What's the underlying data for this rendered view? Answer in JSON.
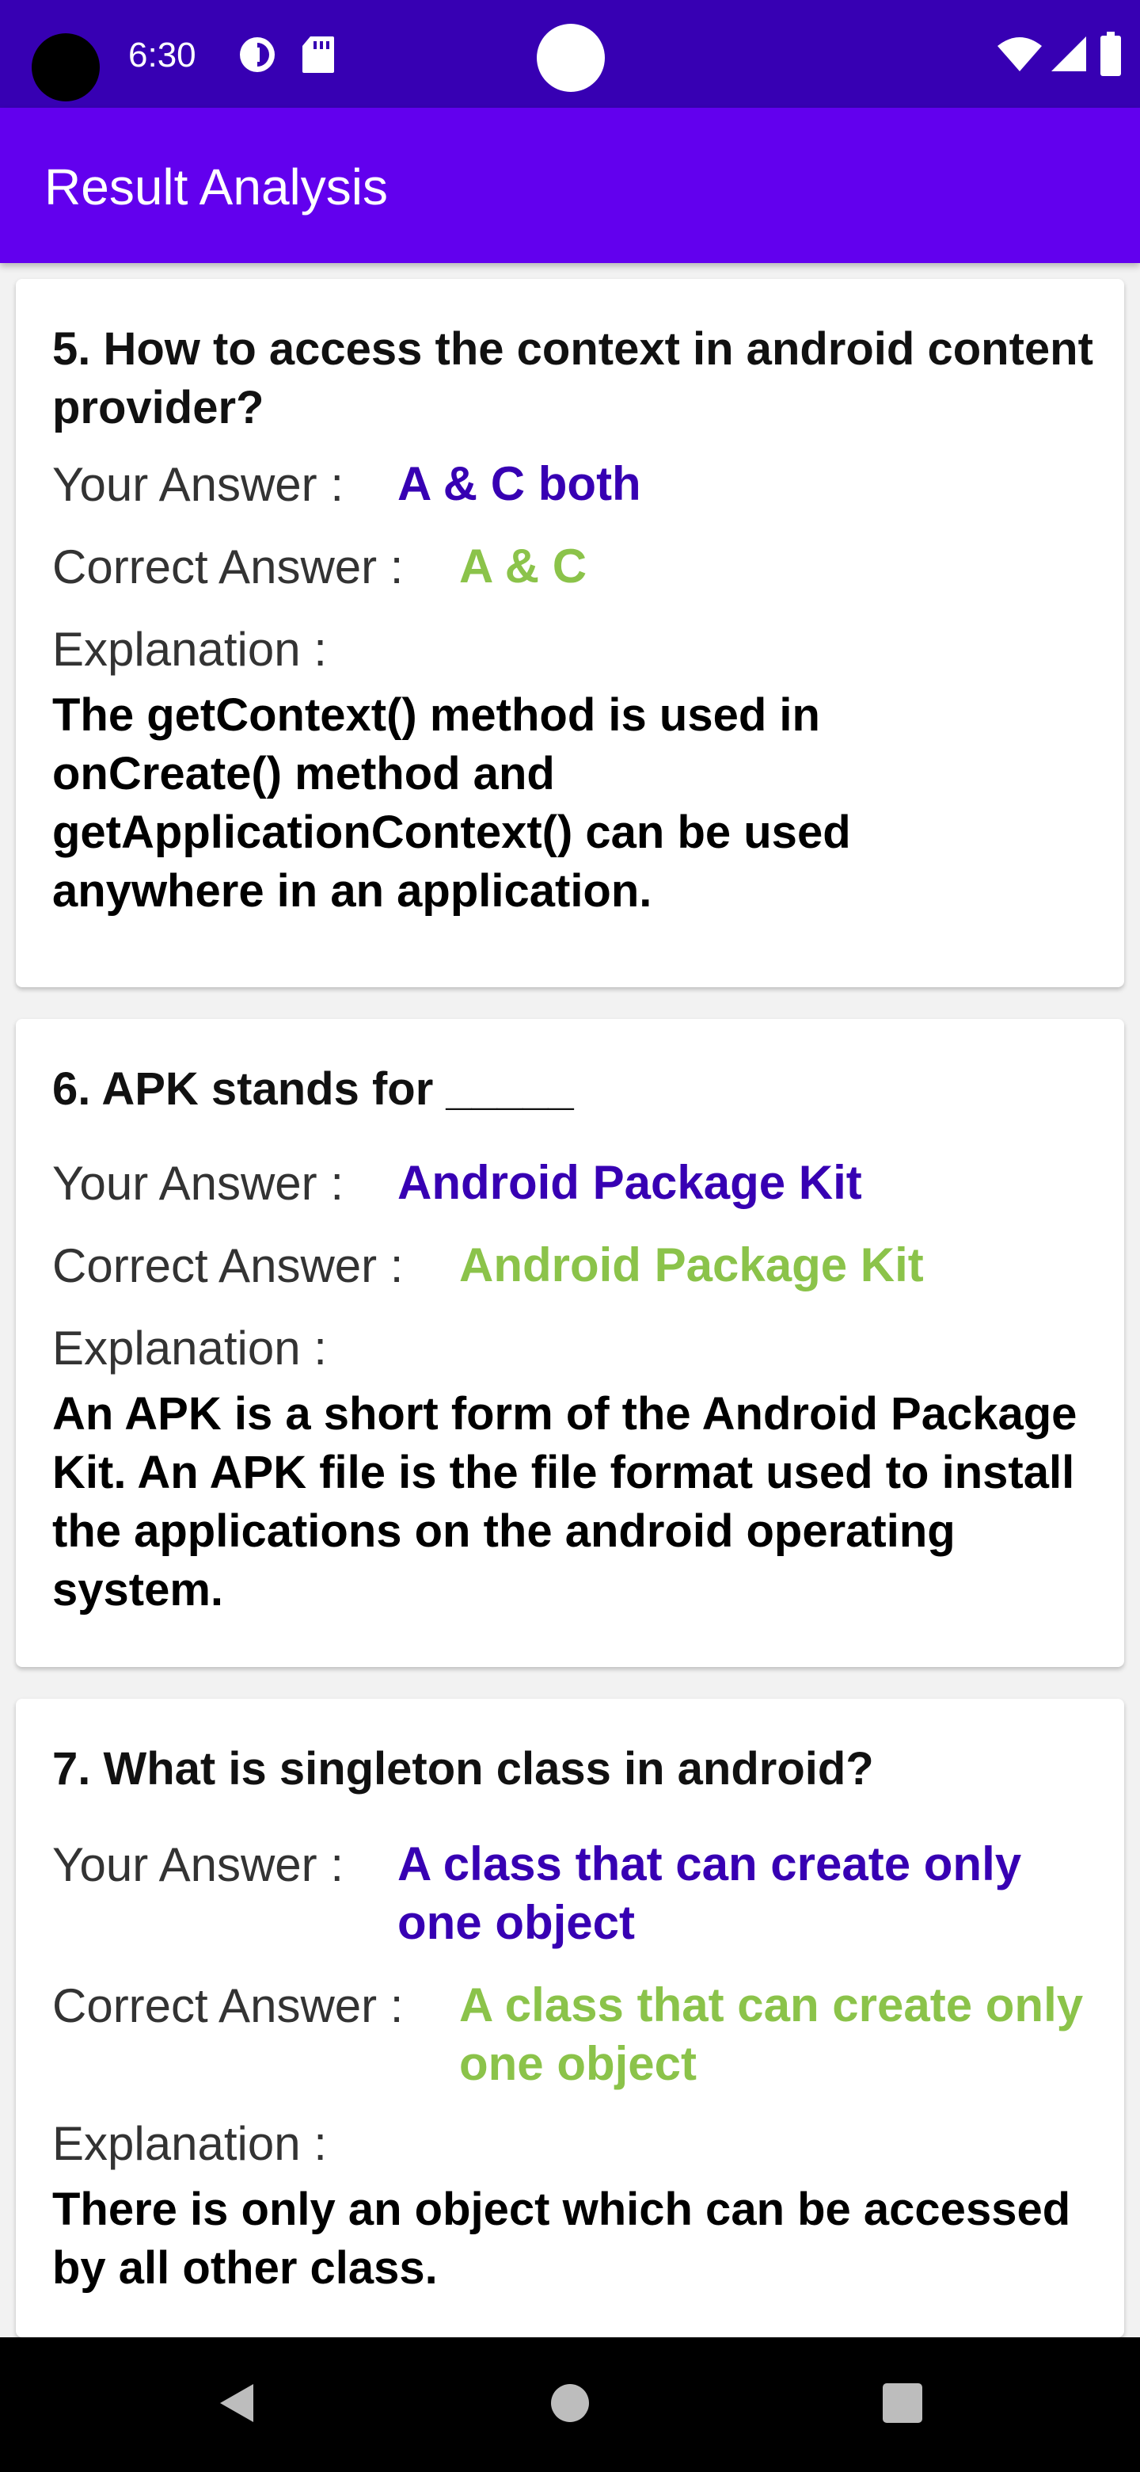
{
  "status_bar": {
    "time": "6:30",
    "icons": [
      "data-saver-icon",
      "sd-card-icon",
      "wifi-icon",
      "signal-icon",
      "battery-icon"
    ]
  },
  "app_bar": {
    "title": "Result Analysis"
  },
  "labels": {
    "your_answer": "Your Answer :",
    "correct_answer": "Correct Answer :",
    "explanation": "Explanation :"
  },
  "colors": {
    "status_bar": "#3700b3",
    "app_bar": "#6200ee",
    "your_answer": "#3700b3",
    "correct_answer": "#8bc34a"
  },
  "questions": [
    {
      "question": "5. How to access the context in android content provider?",
      "your_answer": "A & C both",
      "correct_answer": "A & C",
      "explanation": "The getContext() method is used in onCreate() method and getApplicationContext() can be used anywhere in an application."
    },
    {
      "question": "6. APK stands for _____",
      "your_answer": "Android Package Kit",
      "correct_answer": "Android Package Kit",
      "explanation": "An APK is a short form of the Android Package Kit. An APK file is the file format used to install the applications on the android operating system."
    },
    {
      "question": "7. What is singleton class in android?",
      "your_answer": "A class that can create only one object",
      "correct_answer": "A class that can create only one object",
      "explanation": "There is only an object which can be accessed by all other class."
    }
  ],
  "nav_bar": {
    "buttons": [
      "back-icon",
      "home-icon",
      "recents-icon"
    ]
  }
}
